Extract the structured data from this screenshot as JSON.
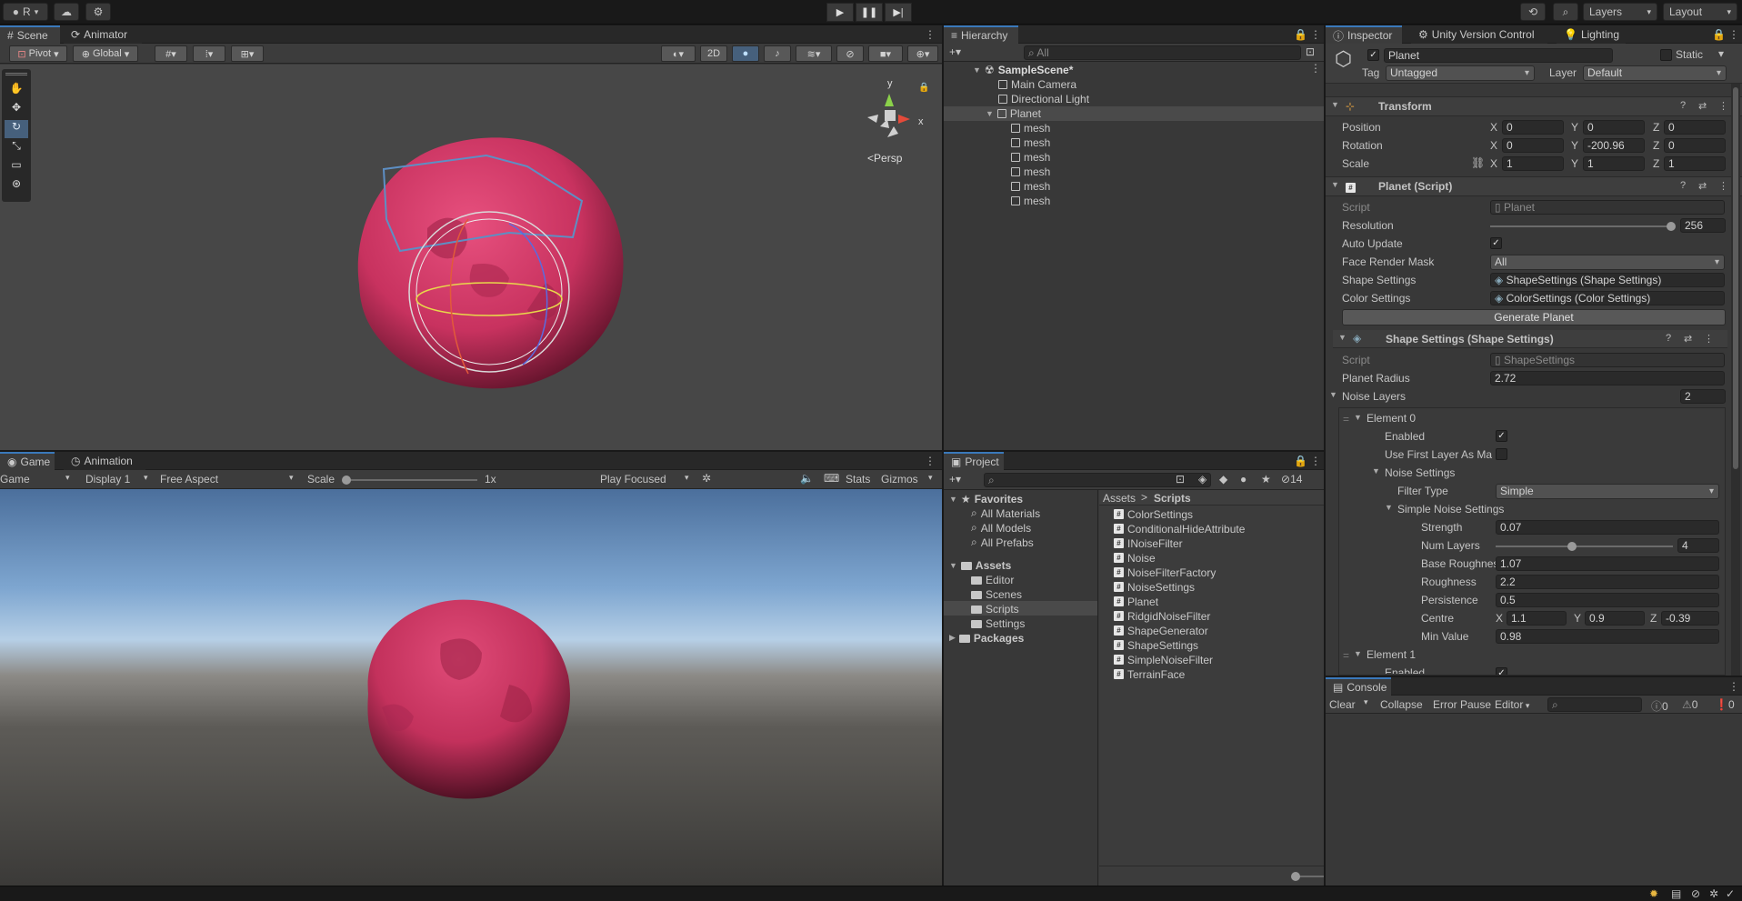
{
  "toolbar": {
    "account_label": "R",
    "layers_label": "Layers",
    "layout_label": "Layout"
  },
  "scene": {
    "tabs": [
      "Scene",
      "Animator"
    ],
    "pivot_label": "Pivot",
    "global_label": "Global",
    "mode_2d_label": "2D",
    "persp_label": "Persp",
    "gizmo_axes": [
      "y",
      "x"
    ]
  },
  "game": {
    "tabs": [
      "Game",
      "Animation"
    ],
    "view_label": "Game",
    "display_label": "Display 1",
    "aspect_label": "Free Aspect",
    "scale_label": "Scale",
    "scale_value": "1x",
    "scale_fraction": 0.0,
    "play_mode_label": "Play Focused",
    "stats_label": "Stats",
    "gizmos_label": "Gizmos"
  },
  "hierarchy": {
    "tab": "Hierarchy",
    "search_placeholder": "All",
    "scene_name": "SampleScene*",
    "items": [
      {
        "label": "Main Camera",
        "depth": 1
      },
      {
        "label": "Directional Light",
        "depth": 1
      },
      {
        "label": "Planet",
        "depth": 1,
        "selected": true
      },
      {
        "label": "mesh",
        "depth": 2
      },
      {
        "label": "mesh",
        "depth": 2
      },
      {
        "label": "mesh",
        "depth": 2
      },
      {
        "label": "mesh",
        "depth": 2
      },
      {
        "label": "mesh",
        "depth": 2
      },
      {
        "label": "mesh",
        "depth": 2
      }
    ]
  },
  "project": {
    "tab": "Project",
    "hidden_count": "14",
    "favorites_label": "Favorites",
    "favorites": [
      "All Materials",
      "All Models",
      "All Prefabs"
    ],
    "assets_label": "Assets",
    "asset_folders": [
      "Editor",
      "Scenes",
      "Scripts",
      "Settings"
    ],
    "packages_label": "Packages",
    "breadcrumb": [
      "Assets",
      "Scripts"
    ],
    "files": [
      "ColorSettings",
      "ConditionalHideAttribute",
      "INoiseFilter",
      "Noise",
      "NoiseFilterFactory",
      "NoiseSettings",
      "Planet",
      "RidgidNoiseFilter",
      "ShapeGenerator",
      "ShapeSettings",
      "SimpleNoiseFilter",
      "TerrainFace"
    ]
  },
  "inspector": {
    "tabs": [
      "Inspector",
      "Unity Version Control",
      "Lighting"
    ],
    "object_name": "Planet",
    "static_label": "Static",
    "tag_label": "Tag",
    "tag_value": "Untagged",
    "layer_label": "Layer",
    "layer_value": "Default",
    "transform": {
      "title": "Transform",
      "position_label": "Position",
      "rotation_label": "Rotation",
      "scale_label": "Scale",
      "position": [
        "0",
        "0",
        "0"
      ],
      "rotation": [
        "0",
        "-200.96",
        "0"
      ],
      "scale": [
        "1",
        "1",
        "1"
      ]
    },
    "planet_script": {
      "title": "Planet (Script)",
      "script_label": "Script",
      "script_value": "Planet",
      "resolution_label": "Resolution",
      "resolution_value": "256",
      "resolution_fraction": 0.98,
      "auto_update_label": "Auto Update",
      "face_mask_label": "Face Render Mask",
      "face_mask_value": "All",
      "shape_settings_label": "Shape Settings",
      "shape_settings_value": "ShapeSettings (Shape Settings)",
      "color_settings_label": "Color Settings",
      "color_settings_value": "ColorSettings (Color Settings)",
      "generate_button": "Generate Planet"
    },
    "shape_settings": {
      "title": "Shape Settings (Shape Settings)",
      "script_label": "Script",
      "script_value": "ShapeSettings",
      "radius_label": "Planet Radius",
      "radius_value": "2.72",
      "noise_layers_label": "Noise Layers",
      "noise_layers_count": "2",
      "element0_label": "Element 0",
      "enabled_label": "Enabled",
      "use_first_label": "Use First Layer As Ma",
      "noise_settings_label": "Noise Settings",
      "filter_type_label": "Filter Type",
      "filter_type_value": "Simple",
      "simple_noise_label": "Simple Noise Settings",
      "strength_label": "Strength",
      "strength_value": "0.07",
      "num_layers_label": "Num Layers",
      "num_layers_value": "4",
      "num_layers_fraction": 0.42,
      "base_roughness_label": "Base Roughness",
      "base_roughness_value": "1.07",
      "roughness_label": "Roughness",
      "roughness_value": "2.2",
      "persistence_label": "Persistence",
      "persistence_value": "0.5",
      "centre_label": "Centre",
      "centre": [
        "1.1",
        "0.9",
        "-0.39"
      ],
      "min_value_label": "Min Value",
      "min_value_value": "0.98",
      "element1_label": "Element 1",
      "enabled_label_2": "Enabled"
    },
    "axis_x": "X",
    "axis_y": "Y",
    "axis_z": "Z"
  },
  "console": {
    "tab": "Console",
    "clear_label": "Clear",
    "collapse_label": "Collapse",
    "error_pause_label": "Error Pause",
    "editor_label": "Editor",
    "info_count": "0",
    "warn_count": "0",
    "error_count": "0"
  },
  "colors": {
    "accent": "#3a79bb",
    "planet": "#c8325f",
    "panel": "#383838",
    "field": "#2a2a2a"
  }
}
